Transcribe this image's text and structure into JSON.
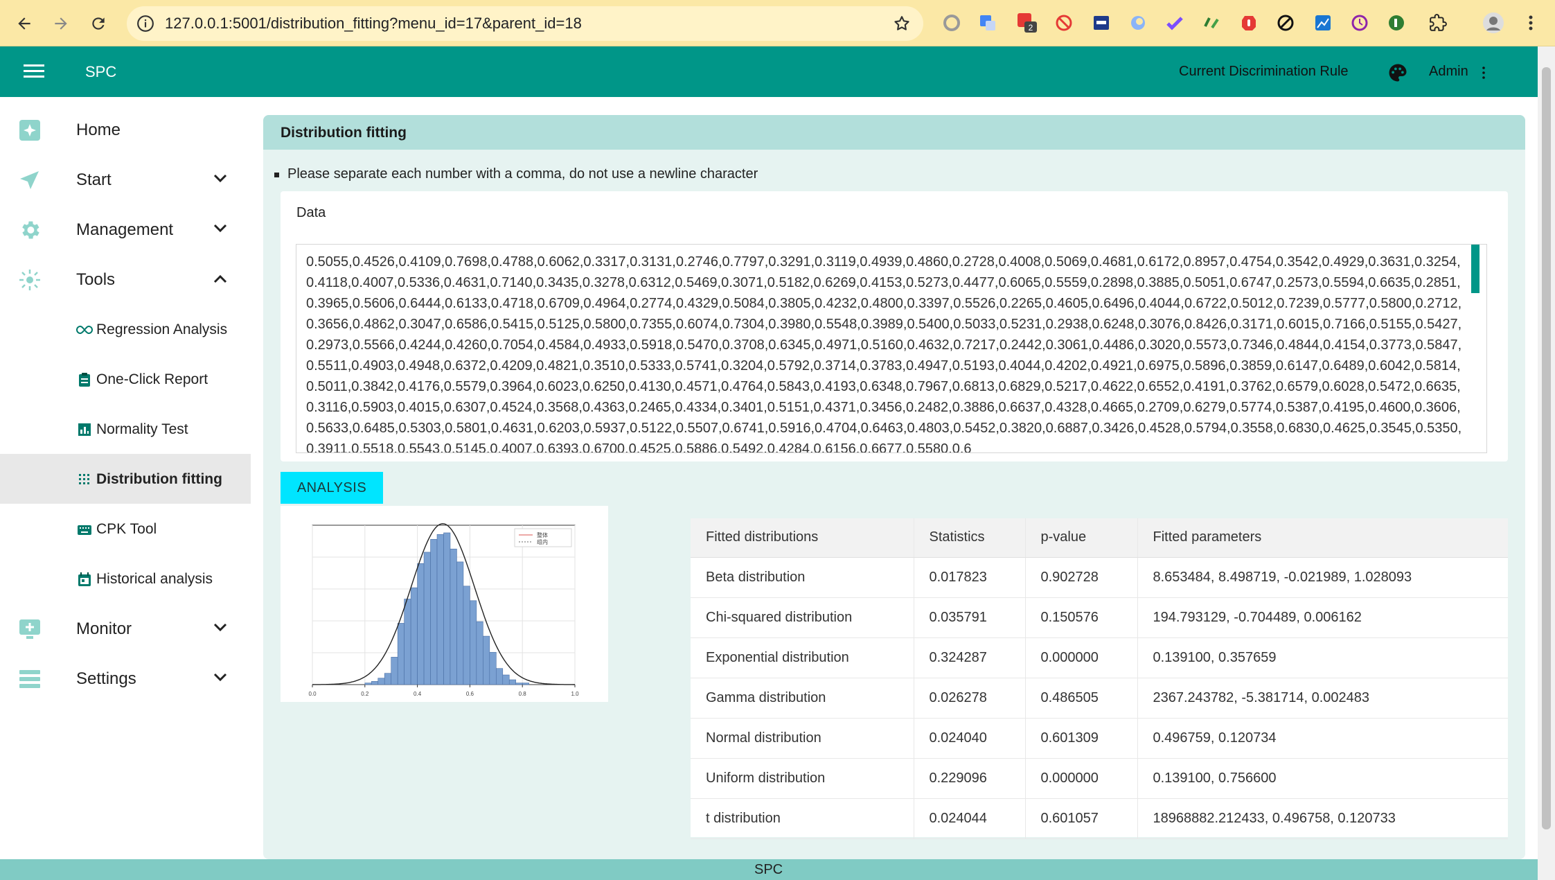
{
  "browser": {
    "url": "127.0.0.1:5001/distribution_fitting?menu_id=17&parent_id=18",
    "badge_count": "2"
  },
  "header": {
    "app_title": "SPC",
    "rule_link": "Current Discrimination Rule",
    "user": "Admin"
  },
  "sidebar": {
    "items": [
      {
        "label": "Home"
      },
      {
        "label": "Start"
      },
      {
        "label": "Management"
      },
      {
        "label": "Tools"
      },
      {
        "label": "Monitor"
      },
      {
        "label": "Settings"
      }
    ],
    "tools_children": [
      {
        "label": "Regression Analysis"
      },
      {
        "label": "One-Click Report"
      },
      {
        "label": "Normality Test"
      },
      {
        "label": "Distribution fitting"
      },
      {
        "label": "CPK Tool"
      },
      {
        "label": "Historical analysis"
      }
    ]
  },
  "main": {
    "title": "Distribution fitting",
    "hint": "Please separate each number with a comma, do not use a newline character",
    "data_label": "Data",
    "data_value": "0.5055,0.4526,0.4109,0.7698,0.4788,0.6062,0.3317,0.3131,0.2746,0.7797,0.3291,0.3119,0.4939,0.4860,0.2728,0.4008,0.5069,0.4681,0.6172,0.8957,0.4754,0.3542,0.4929,0.3631,0.3254,0.4118,0.4007,0.5336,0.4631,0.7140,0.3435,0.3278,0.6312,0.5469,0.3071,0.5182,0.6269,0.4153,0.5273,0.4477,0.6065,0.5559,0.2898,0.3885,0.5051,0.6747,0.2573,0.5594,0.6635,0.2851,0.3965,0.5606,0.6444,0.6133,0.4718,0.6709,0.4964,0.2774,0.4329,0.5084,0.3805,0.4232,0.4800,0.3397,0.5526,0.2265,0.4605,0.6496,0.4044,0.6722,0.5012,0.7239,0.5777,0.5800,0.2712,0.3656,0.4862,0.3047,0.6586,0.5415,0.5125,0.5800,0.7355,0.6074,0.7304,0.3980,0.5548,0.3989,0.5400,0.5033,0.5231,0.2938,0.6248,0.3076,0.8426,0.3171,0.6015,0.7166,0.5155,0.5427,0.2973,0.5566,0.4244,0.4260,0.7054,0.4584,0.4933,0.5918,0.5470,0.3708,0.6345,0.4971,0.5160,0.4632,0.7217,0.2442,0.3061,0.4486,0.3020,0.5573,0.7346,0.4844,0.4154,0.3773,0.5847,0.5511,0.4903,0.4948,0.6372,0.4209,0.4821,0.3510,0.5333,0.5741,0.3204,0.5792,0.3714,0.3783,0.4947,0.5193,0.4044,0.4202,0.4921,0.6975,0.5896,0.3859,0.6147,0.6489,0.6042,0.5814,0.5011,0.3842,0.4176,0.5579,0.3964,0.6023,0.6250,0.4130,0.4571,0.4764,0.5843,0.4193,0.6348,0.7967,0.6813,0.6829,0.5217,0.4622,0.6552,0.4191,0.3762,0.6579,0.6028,0.5472,0.6635,0.3116,0.5903,0.4015,0.6307,0.4524,0.3568,0.4363,0.2465,0.4334,0.3401,0.5151,0.4371,0.3456,0.2482,0.3886,0.6637,0.4328,0.4665,0.2709,0.6279,0.5774,0.5387,0.4195,0.4600,0.3606,0.5633,0.6485,0.5303,0.5801,0.4631,0.6203,0.5937,0.5122,0.5507,0.6741,0.5916,0.4704,0.6463,0.4803,0.5452,0.3820,0.6887,0.3426,0.4528,0.5794,0.3558,0.6830,0.4625,0.3545,0.5350,0.3911,0.5518,0.5543,0.5145,0.4007,0.6393,0.6700,0.4525,0.5886,0.5492,0.4284,0.6156,0.6677,0.5580,0.6",
    "analysis_button": "ANALYSIS"
  },
  "chart_data": {
    "type": "bar",
    "x": [
      0.0,
      0.025,
      0.05,
      0.075,
      0.1,
      0.125,
      0.15,
      0.175,
      0.2,
      0.225,
      0.25,
      0.275,
      0.3,
      0.325,
      0.35,
      0.375,
      0.4,
      0.425,
      0.45,
      0.475,
      0.5,
      0.525,
      0.55,
      0.575,
      0.6,
      0.625,
      0.65,
      0.675,
      0.7,
      0.725,
      0.75,
      0.775,
      0.8,
      0.825,
      0.85,
      0.875,
      0.9,
      0.925,
      0.95,
      0.975
    ],
    "bin_width": 0.025,
    "values": [
      0,
      0,
      0,
      0,
      0,
      0,
      0,
      0,
      0.05,
      0.1,
      0.2,
      0.35,
      0.85,
      1.9,
      2.65,
      3.0,
      3.75,
      4.1,
      4.5,
      4.65,
      4.7,
      4.2,
      3.8,
      3.05,
      2.6,
      1.95,
      1.5,
      1.0,
      0.5,
      0.3,
      0.15,
      0.05,
      0.05,
      0,
      0,
      0,
      0,
      0,
      0,
      0
    ],
    "fit_curve": {
      "type": "normal",
      "mean": 0.496759,
      "std": 0.120734
    },
    "legend": [
      "整体",
      "组内"
    ],
    "xticks": [
      "0.0",
      "0.2",
      "0.4",
      "0.6",
      "0.8",
      "1.0"
    ],
    "xlim": [
      0.0,
      1.0
    ],
    "ylim": [
      0,
      3.5
    ],
    "legend_position": "top-right",
    "grid": true,
    "colors": {
      "bars": "#7ba1d2",
      "bar_edge": "#4a6fa5",
      "curve": "#222222"
    }
  },
  "results": {
    "headers": [
      "Fitted distributions",
      "Statistics",
      "p-value",
      "Fitted parameters"
    ],
    "rows": [
      [
        "Beta distribution",
        "0.017823",
        "0.902728",
        "8.653484, 8.498719, -0.021989, 1.028093"
      ],
      [
        "Chi-squared distribution",
        "0.035791",
        "0.150576",
        "194.793129, -0.704489, 0.006162"
      ],
      [
        "Exponential distribution",
        "0.324287",
        "0.000000",
        "0.139100, 0.357659"
      ],
      [
        "Gamma distribution",
        "0.026278",
        "0.486505",
        "2367.243782, -5.381714, 0.002483"
      ],
      [
        "Normal distribution",
        "0.024040",
        "0.601309",
        "0.496759, 0.120734"
      ],
      [
        "Uniform distribution",
        "0.229096",
        "0.000000",
        "0.139100, 0.756600"
      ],
      [
        "t distribution",
        "0.024044",
        "0.601057",
        "18968882.212433, 0.496758, 0.120733"
      ]
    ]
  },
  "footer": {
    "text": "SPC"
  },
  "colors": {
    "primary": "#009688",
    "panel": "#e6f3f1",
    "panel_header": "#b2dfdb",
    "button": "#00e5ff",
    "footer": "#80cbc4"
  }
}
